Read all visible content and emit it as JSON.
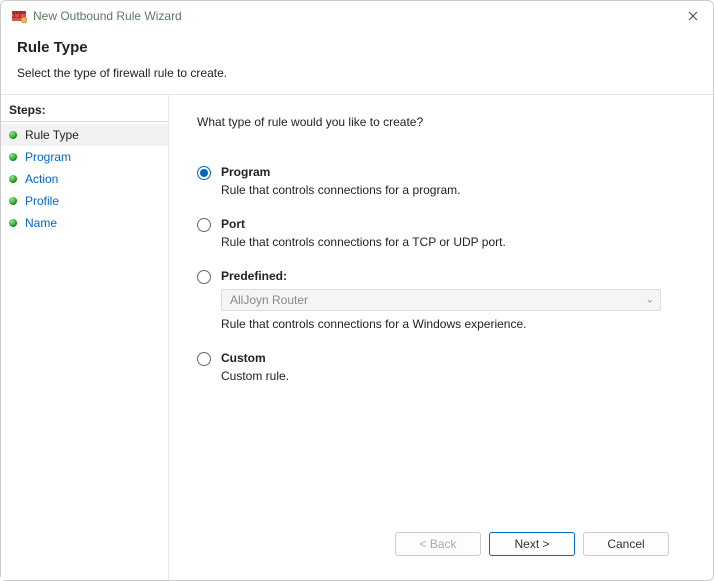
{
  "window": {
    "title": "New Outbound Rule Wizard"
  },
  "header": {
    "title": "Rule Type",
    "subtitle": "Select the type of firewall rule to create."
  },
  "sidebar": {
    "title": "Steps:",
    "items": [
      {
        "label": "Rule Type",
        "active": true
      },
      {
        "label": "Program",
        "active": false
      },
      {
        "label": "Action",
        "active": false
      },
      {
        "label": "Profile",
        "active": false
      },
      {
        "label": "Name",
        "active": false
      }
    ]
  },
  "content": {
    "question": "What type of rule would you like to create?",
    "options": [
      {
        "key": "program",
        "title": "Program",
        "desc": "Rule that controls connections for a program.",
        "selected": true
      },
      {
        "key": "port",
        "title": "Port",
        "desc": "Rule that controls connections for a TCP or UDP port.",
        "selected": false
      },
      {
        "key": "predefined",
        "title": "Predefined:",
        "dropdown": "AllJoyn Router",
        "desc": "Rule that controls connections for a Windows experience.",
        "selected": false
      },
      {
        "key": "custom",
        "title": "Custom",
        "desc": "Custom rule.",
        "selected": false
      }
    ]
  },
  "footer": {
    "back": "< Back",
    "next": "Next >",
    "cancel": "Cancel"
  }
}
